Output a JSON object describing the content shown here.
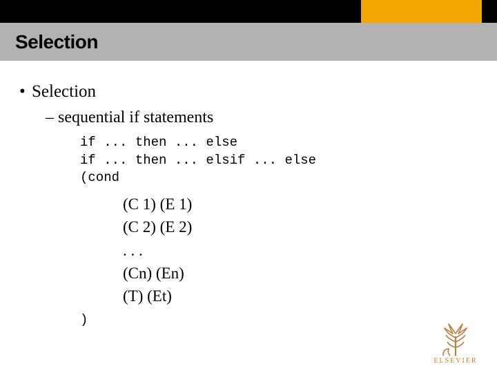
{
  "header": {
    "title": "Selection"
  },
  "body": {
    "bullet1": "Selection",
    "sub1": "sequential if statements",
    "code": {
      "line1": "if ... then ... else",
      "line2": "if ... then ... elsif ... else",
      "line3": "(cond"
    },
    "cond": {
      "c1": "(C 1) (E 1)",
      "c2": "(C 2) (E 2)",
      "ellipsis": ". . .",
      "cn": "(Cn) (En)",
      "ct": "(T)  (Et)"
    },
    "close": ")"
  },
  "logo": {
    "name": "ELSEVIER",
    "accent": "#e07a10"
  }
}
